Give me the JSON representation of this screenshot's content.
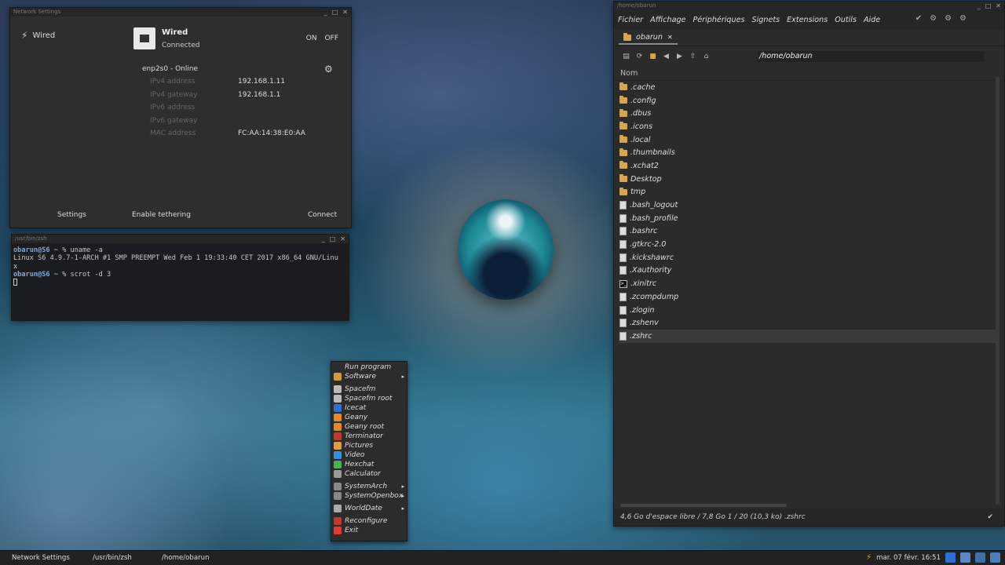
{
  "network": {
    "title": "Network Settings",
    "side_label": "Wired",
    "wired_title": "Wired",
    "wired_status": "Connected",
    "on": "ON",
    "off": "OFF",
    "interface": "enp2s0 - Online",
    "props": [
      {
        "k": "IPv4 address",
        "v": "192.168.1.11"
      },
      {
        "k": "IPv4 gateway",
        "v": "192.168.1.1"
      },
      {
        "k": "IPv6 address",
        "v": ""
      },
      {
        "k": "IPv6 gateway",
        "v": ""
      },
      {
        "k": "MAC address",
        "v": "FC:AA:14:38:E0:AA"
      }
    ],
    "settings": "Settings",
    "tethering": "Enable tethering",
    "connect": "Connect"
  },
  "terminal": {
    "title": "/usr/bin/zsh",
    "prompt1": "obarun@S6",
    "cmd1": " ~ % uname -a",
    "out1": "Linux S6 4.9.7-1-ARCH #1 SMP PREEMPT Wed Feb 1 19:33:40 CET 2017 x86_64 GNU/Linu\nx",
    "prompt2": "obarun@S6",
    "cmd2": " ~ % scrot -d 3"
  },
  "fm": {
    "title": "/home/obarun",
    "menus": [
      "Fichier",
      "Affichage",
      "Périphériques",
      "Signets",
      "Extensions",
      "Outils",
      "Aide"
    ],
    "tab": "obarun",
    "path": "/home/obarun",
    "column": "Nom",
    "files": [
      {
        "name": ".cache",
        "type": "folder"
      },
      {
        "name": ".config",
        "type": "folder"
      },
      {
        "name": ".dbus",
        "type": "folder"
      },
      {
        "name": ".icons",
        "type": "folder"
      },
      {
        "name": ".local",
        "type": "folder"
      },
      {
        "name": ".thumbnails",
        "type": "folder"
      },
      {
        "name": ".xchat2",
        "type": "folder"
      },
      {
        "name": "Desktop",
        "type": "folder"
      },
      {
        "name": "tmp",
        "type": "folder"
      },
      {
        "name": ".bash_logout",
        "type": "file"
      },
      {
        "name": ".bash_profile",
        "type": "file"
      },
      {
        "name": ".bashrc",
        "type": "file"
      },
      {
        "name": ".gtkrc-2.0",
        "type": "file"
      },
      {
        "name": ".kickshawrc",
        "type": "file"
      },
      {
        "name": ".Xauthority",
        "type": "file"
      },
      {
        "name": ".xinitrc",
        "type": "script"
      },
      {
        "name": ".zcompdump",
        "type": "file"
      },
      {
        "name": ".zlogin",
        "type": "file"
      },
      {
        "name": ".zshenv",
        "type": "file"
      },
      {
        "name": ".zshrc",
        "type": "file",
        "selected": true
      }
    ],
    "status": "4,6 Go d'espace libre / 7,8 Go   1 / 20 (10,3 ko)   .zshrc"
  },
  "menu": {
    "items": [
      {
        "label": "Run program",
        "icon": "",
        "arrow": false
      },
      {
        "label": "Software",
        "icon": "#d59a3a",
        "arrow": true
      },
      {
        "sep": true
      },
      {
        "label": "Spacefm",
        "icon": "#bbbbbb",
        "arrow": false
      },
      {
        "label": "Spacefm root",
        "icon": "#bbbbbb",
        "arrow": false
      },
      {
        "label": "Icecat",
        "icon": "#2f6fd0",
        "arrow": false
      },
      {
        "label": "Geany",
        "icon": "#e08a2b",
        "arrow": false
      },
      {
        "label": "Geany root",
        "icon": "#e08a2b",
        "arrow": false
      },
      {
        "label": "Terminator",
        "icon": "#c0392b",
        "arrow": false
      },
      {
        "label": "Pictures",
        "icon": "#d9a040",
        "arrow": false
      },
      {
        "label": "Video",
        "icon": "#3b8fd9",
        "arrow": false
      },
      {
        "label": "Hexchat",
        "icon": "#4caf50",
        "arrow": false
      },
      {
        "label": "Calculator",
        "icon": "#999999",
        "arrow": false
      },
      {
        "sep": true
      },
      {
        "label": "SystemArch",
        "icon": "#888888",
        "arrow": true
      },
      {
        "label": "SystemOpenbox",
        "icon": "#888888",
        "arrow": true
      },
      {
        "sep": true
      },
      {
        "label": "WorldDate",
        "icon": "#aaaaaa",
        "arrow": true
      },
      {
        "sep": true
      },
      {
        "label": "Reconfigure",
        "icon": "#c0392b",
        "arrow": false
      },
      {
        "label": "Exit",
        "icon": "#e53935",
        "arrow": false
      }
    ]
  },
  "taskbar": {
    "tasks": [
      "Network Settings",
      "/usr/bin/zsh",
      "/home/obarun"
    ],
    "clock": "mar. 07 févr.  16:51"
  }
}
